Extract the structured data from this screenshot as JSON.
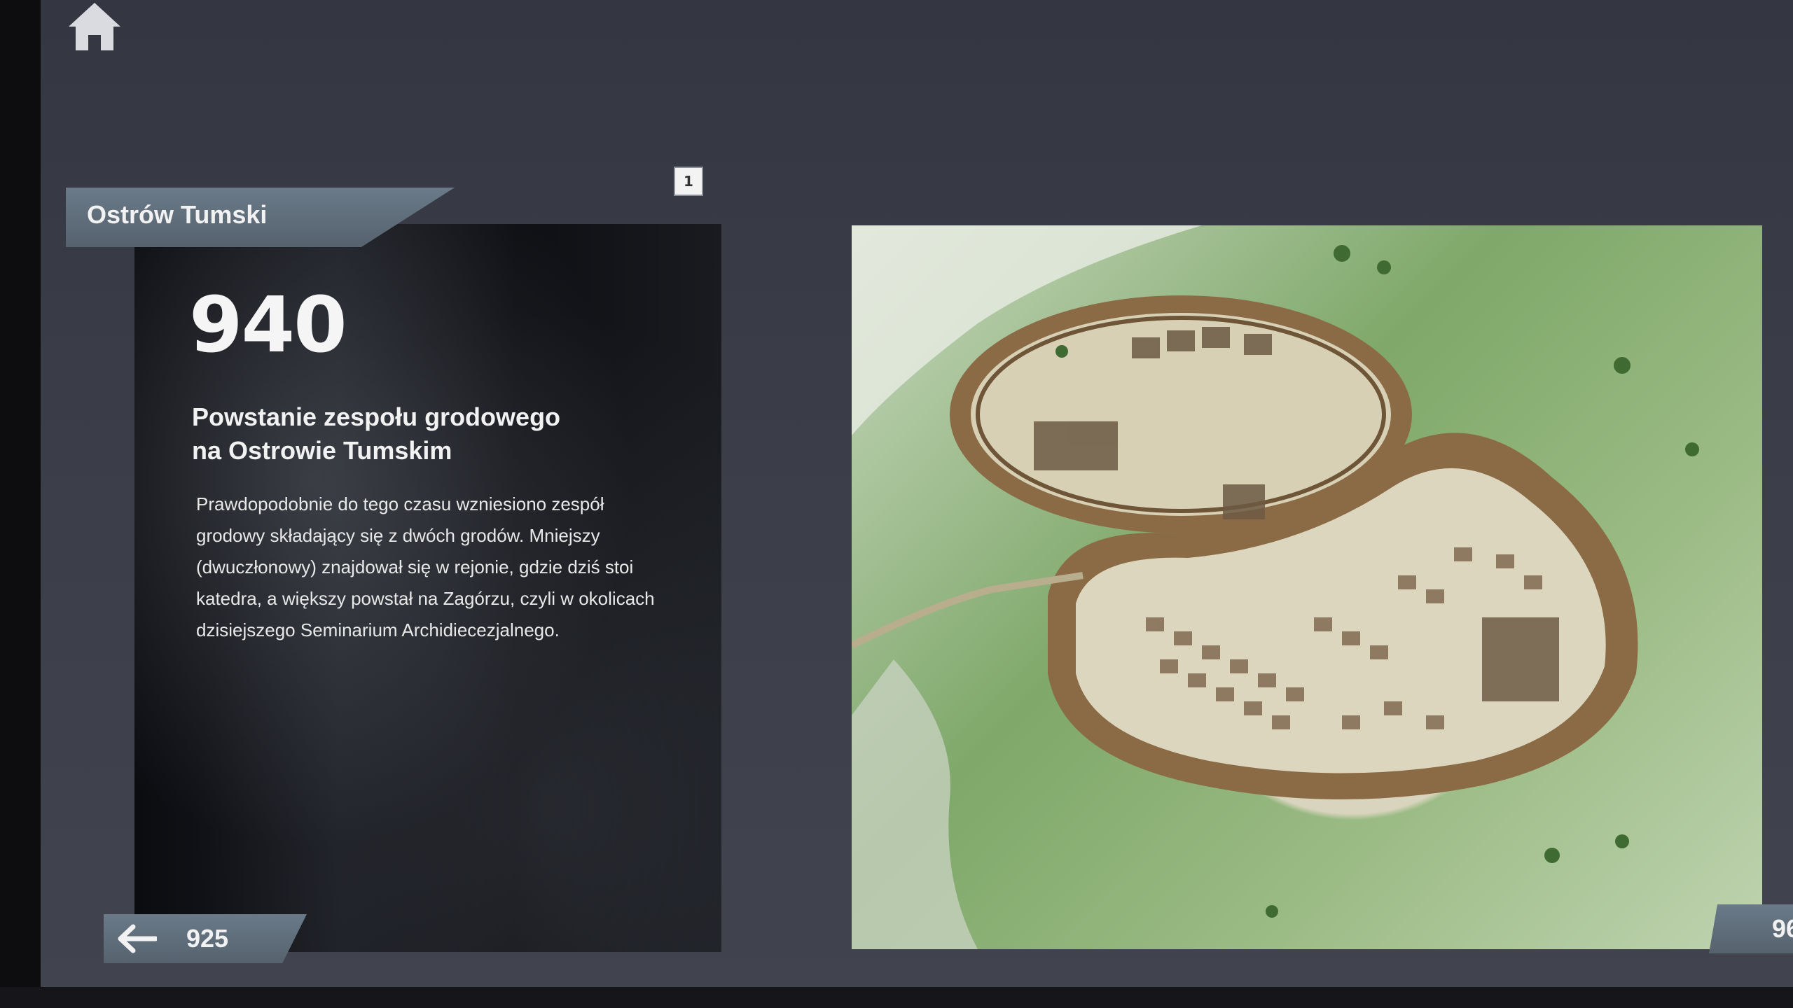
{
  "header": {
    "home_icon": "home-icon",
    "page_number": "1"
  },
  "section": {
    "title": "Ostrów Tumski"
  },
  "event": {
    "year": "940",
    "title": "Powstanie zespołu grodowego\nna Ostrowie Tumskim",
    "description": "Prawdopodobnie do tego czasu wzniesiono zespół grodowy składający się z dwóch grodów. Mniejszy (dwuczłonowy) znajdował się w rejonie, gdzie dziś stoi katedra, a większy powstał na Zagórzu, czyli w okolicach dzisiejszego Seminarium Archidiecezjalnego."
  },
  "navigation": {
    "prev_label": "925",
    "prev_icon": "arrow-left-icon",
    "next_label": "96"
  }
}
